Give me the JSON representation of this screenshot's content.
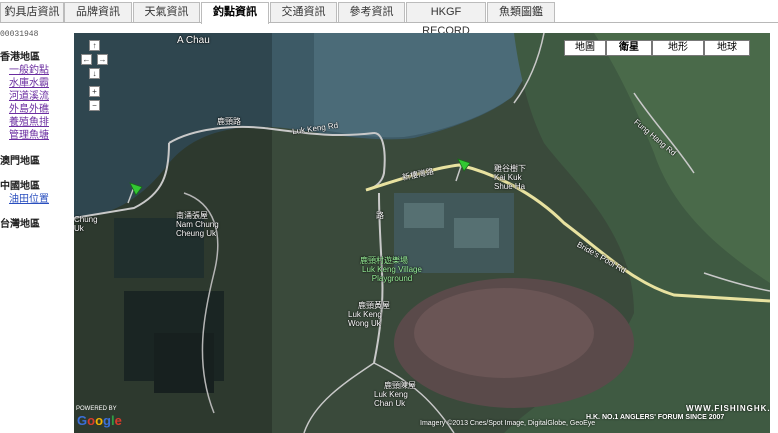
{
  "tabs": [
    {
      "label": "釣具店資訊",
      "active": false
    },
    {
      "label": "品牌資訊",
      "active": false
    },
    {
      "label": "天氣資訊",
      "active": false
    },
    {
      "label": "釣點資訊",
      "active": true
    },
    {
      "label": "交通資訊",
      "active": false
    },
    {
      "label": "參考資訊",
      "active": false
    },
    {
      "label": "HKGF RECORD",
      "active": false
    },
    {
      "label": "魚類圖鑑",
      "active": false
    }
  ],
  "sidebar": {
    "counter": "00031948",
    "hk_region": "香港地區",
    "hk_links": [
      "一般釣點",
      "水庫水霸",
      "河道溪流",
      "外島外礁",
      "養殖魚排",
      "管理魚塘"
    ],
    "macau_region": "澳門地區",
    "china_region": "中國地區",
    "china_links": [
      "油田位置"
    ],
    "taiwan_region": "台灣地區"
  },
  "map": {
    "map_types": [
      {
        "label": "地圖",
        "active": false
      },
      {
        "label": "衛星",
        "active": true
      },
      {
        "label": "地形",
        "active": false
      },
      {
        "label": "地球",
        "active": false
      }
    ],
    "nav_buttons": [
      "↑",
      "←",
      "→",
      "↓",
      "+",
      "−"
    ],
    "labels": {
      "a_chau": "A Chau",
      "luk_keng_rd_cn": "鹿頸路",
      "luk_keng_rd_en": "Luk Keng Rd",
      "san_lau_chi_cn": "新樓灣路",
      "kai_kuk_cn": "雞谷樹下",
      "kai_kuk_en": "Kai Kuk Shue Ha",
      "nam_chung_cn": "南涌張屋",
      "nam_chung_en": "Nam Chung Cheung Uk",
      "chung_uk": "Chung Uk",
      "playground_cn": "鹿頸村遊樂場",
      "playground_en": "Luk Keng Village Playground",
      "wong_uk_cn": "鹿頸黃屋",
      "wong_uk_en": "Luk Keng Wong Uk",
      "chan_uk_cn": "鹿頸陳屋",
      "chan_uk_en": "Luk Keng Chan Uk",
      "bride_pool_rd": "Bride's Pool Rd",
      "fung_hang_rd": "Fung Hang Rd",
      "kong_road": "路"
    },
    "attribution": "Imagery ©2013 Cnes/Spot Image, DigitalGlobe, GeoEye",
    "powered_by": "POWERED BY",
    "google_logo": [
      "G",
      "o",
      "o",
      "g",
      "l",
      "e"
    ],
    "watermark_site": "WWW.FISHINGHK.COM",
    "watermark_slogan": "H.K. NO.1 ANGLERS' FORUM SINCE 2007"
  },
  "colors": {
    "google_logo": [
      "#3b6fd8",
      "#d93a2b",
      "#f2b200",
      "#3b6fd8",
      "#2f9e44",
      "#d93a2b"
    ],
    "pin": "#32c832",
    "road_main": "#e8e2a0"
  }
}
